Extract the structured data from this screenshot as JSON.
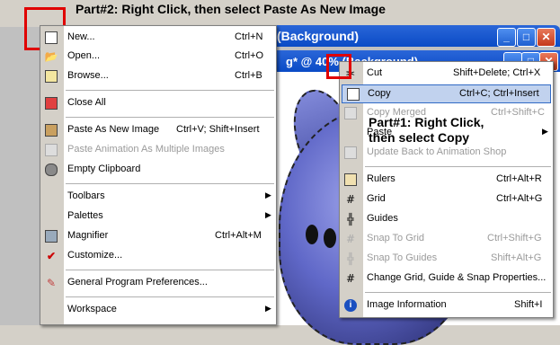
{
  "annotations": {
    "part2": "Part#2: Right Click, then select Paste As New Image",
    "part1_line1": "Part#1: Right Click,",
    "part1_line2": "then select Copy"
  },
  "main_window": {
    "title": "(Background)"
  },
  "image_window": {
    "title": "g* @  40% (Background)"
  },
  "left_menu": {
    "items": [
      {
        "label": "New...",
        "shortcut": "Ctrl+N",
        "icon": "new-document-icon"
      },
      {
        "label": "Open...",
        "shortcut": "Ctrl+O",
        "icon": "open-folder-icon"
      },
      {
        "label": "Browse...",
        "shortcut": "Ctrl+B",
        "icon": "browse-icon"
      },
      {
        "label": "Close All",
        "shortcut": "",
        "icon": "close-all-icon"
      },
      {
        "label": "Paste As New Image",
        "shortcut": "Ctrl+V; Shift+Insert",
        "icon": "paste-new-image-icon"
      },
      {
        "label": "Paste Animation As Multiple Images",
        "shortcut": "",
        "icon": "paste-animation-icon"
      },
      {
        "label": "Empty Clipboard",
        "shortcut": "",
        "icon": "empty-clipboard-icon"
      },
      {
        "label": "Toolbars",
        "shortcut": "",
        "icon": ""
      },
      {
        "label": "Palettes",
        "shortcut": "",
        "icon": ""
      },
      {
        "label": "Magnifier",
        "shortcut": "Ctrl+Alt+M",
        "icon": "magnifier-icon"
      },
      {
        "label": "Customize...",
        "shortcut": "",
        "icon": "checkmark-icon"
      },
      {
        "label": "General Program Preferences...",
        "shortcut": "",
        "icon": "preferences-icon"
      },
      {
        "label": "Workspace",
        "shortcut": "",
        "icon": ""
      }
    ]
  },
  "right_menu": {
    "items": [
      {
        "label": "Cut",
        "shortcut": "Shift+Delete; Ctrl+X",
        "icon": "scissors-icon"
      },
      {
        "label": "Copy",
        "shortcut": "Ctrl+C; Ctrl+Insert",
        "icon": "copy-icon"
      },
      {
        "label": "Copy Merged",
        "shortcut": "Ctrl+Shift+C",
        "icon": "copy-merged-icon"
      },
      {
        "label": "Paste",
        "shortcut": "",
        "icon": ""
      },
      {
        "label": "Update Back to Animation Shop",
        "shortcut": "",
        "icon": "animation-shop-icon"
      },
      {
        "label": "Rulers",
        "shortcut": "Ctrl+Alt+R",
        "icon": "rulers-icon"
      },
      {
        "label": "Grid",
        "shortcut": "Ctrl+Alt+G",
        "icon": "grid-icon"
      },
      {
        "label": "Guides",
        "shortcut": "",
        "icon": "guides-icon"
      },
      {
        "label": "Snap To Grid",
        "shortcut": "Ctrl+Shift+G",
        "icon": "snap-grid-icon"
      },
      {
        "label": "Snap To Guides",
        "shortcut": "Shift+Alt+G",
        "icon": "snap-guides-icon"
      },
      {
        "label": "Change Grid, Guide & Snap Properties...",
        "shortcut": "",
        "icon": "grid-properties-icon"
      },
      {
        "label": "Image Information",
        "shortcut": "Shift+I",
        "icon": "info-icon"
      }
    ]
  }
}
